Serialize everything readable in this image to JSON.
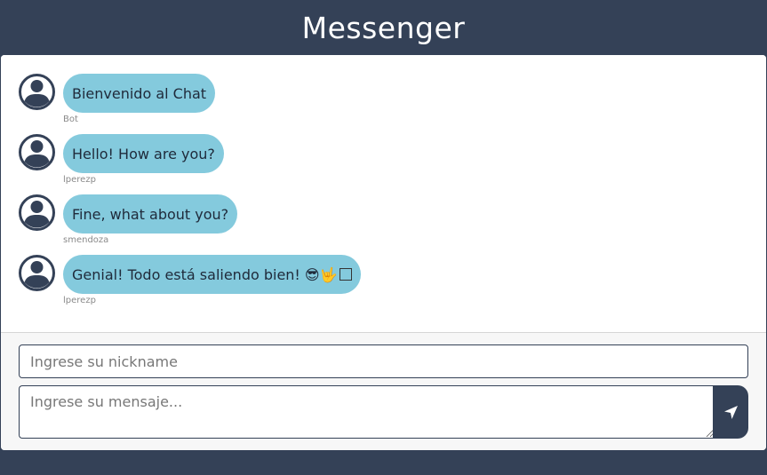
{
  "header": {
    "title": "Messenger"
  },
  "messages": [
    {
      "text": "Bienvenido al Chat",
      "author": "Bot"
    },
    {
      "text": "Hello! How are you?",
      "author": "lperezp"
    },
    {
      "text": "Fine, what about you?",
      "author": "smendoza"
    },
    {
      "text": "Genial! Todo está saliendo bien! 😎🤟",
      "author": "lperezp"
    }
  ],
  "composer": {
    "nickname_placeholder": "Ingrese su nickname",
    "message_placeholder": "Ingrese su mensaje..."
  },
  "icons": {
    "avatar": "user-icon",
    "send": "paper-plane-icon"
  },
  "colors": {
    "header_bg": "#344157",
    "bubble_bg": "#84cadd",
    "send_bg": "#344157"
  }
}
